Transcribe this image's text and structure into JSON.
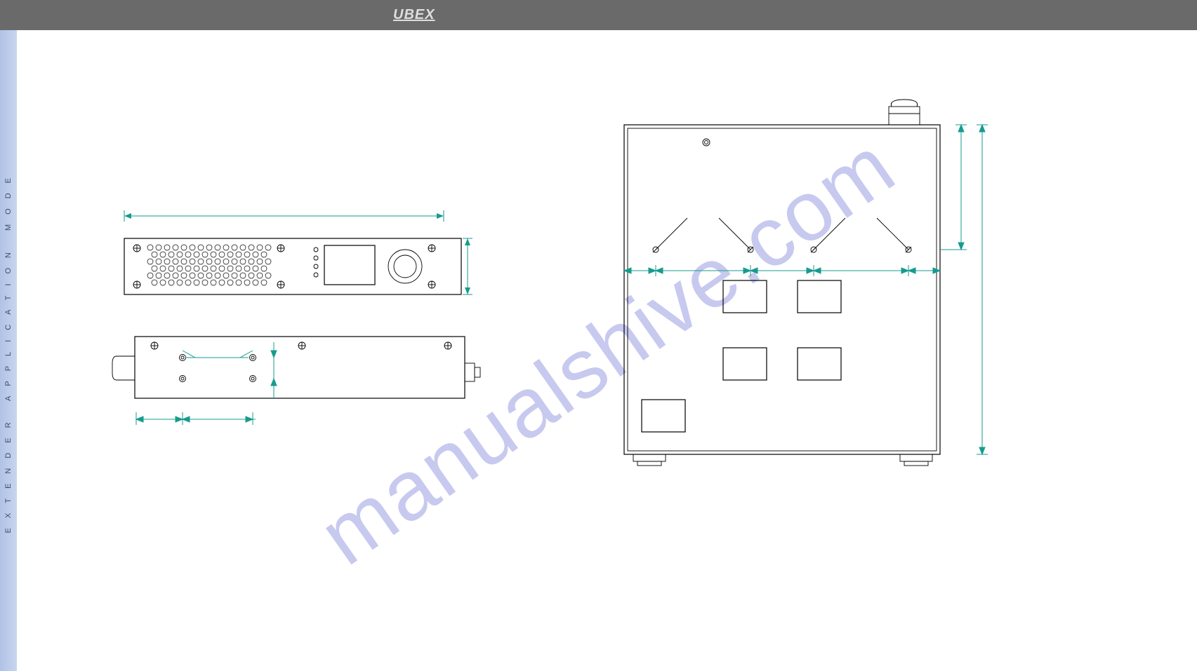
{
  "header": {
    "brand": "UBEX"
  },
  "sidebar": {
    "label": "EXTENDER APPLICATION MODE"
  },
  "watermark": "manualshive.com",
  "drawings": {
    "front_view": {
      "name": "device-front-view"
    },
    "side_view": {
      "name": "device-side-view"
    },
    "top_view": {
      "name": "device-top-view"
    }
  }
}
